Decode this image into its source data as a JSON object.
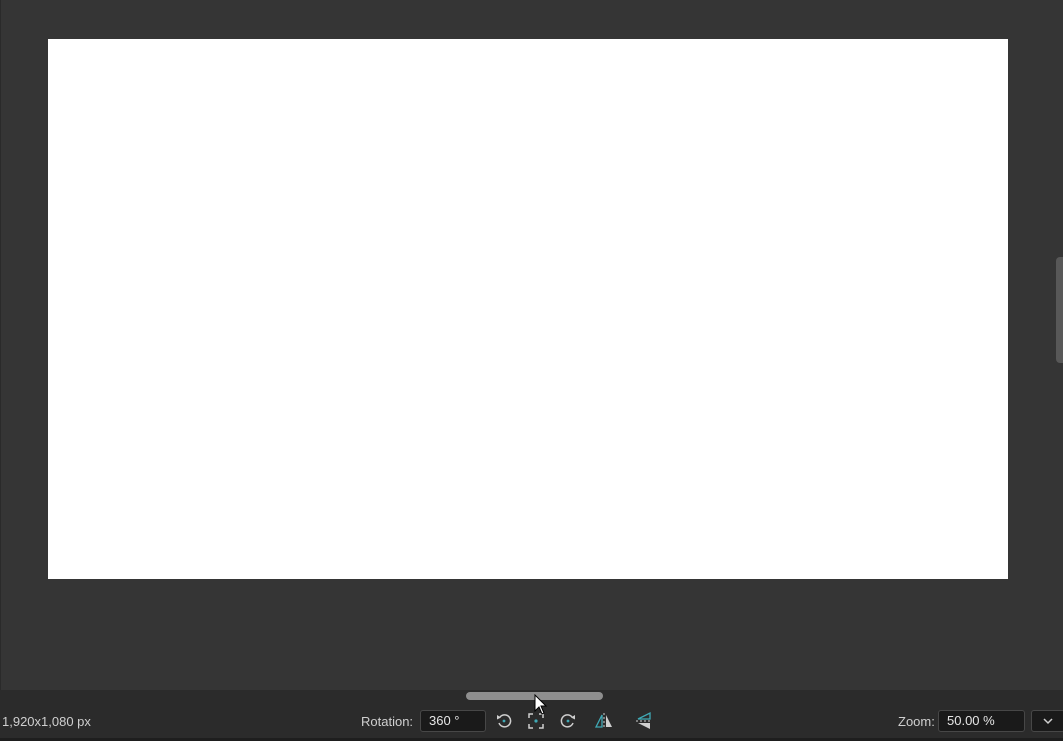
{
  "canvas": {
    "page_color": "#ffffff",
    "background_color": "#353535"
  },
  "statusbar": {
    "dimensions": "1,920x1,080 px",
    "rotation_label": "Rotation:",
    "rotation_value": "360 °",
    "zoom_label": "Zoom:",
    "zoom_value": "50.00 %"
  },
  "icons": {
    "rotate_left": "rotate-ccw-icon",
    "reset_rotation": "reset-rotation-icon",
    "rotate_right": "rotate-cw-icon",
    "flip_horizontal": "flip-horizontal-icon",
    "flip_vertical": "flip-vertical-icon",
    "zoom_dropdown": "chevron-down-icon"
  },
  "colors": {
    "accent": "#3fa9b5"
  }
}
